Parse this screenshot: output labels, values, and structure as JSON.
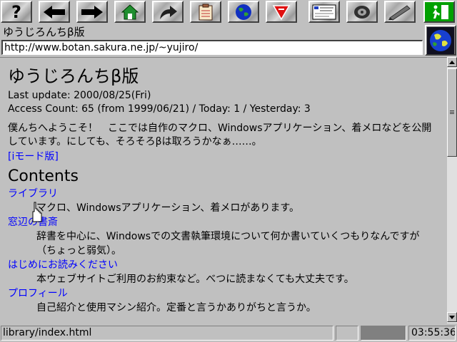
{
  "toolbar": {
    "buttons": [
      {
        "icon": "help-icon",
        "glyph": "?"
      },
      {
        "icon": "back-arrow-icon"
      },
      {
        "icon": "forward-arrow-icon"
      },
      {
        "icon": "home-icon"
      },
      {
        "icon": "reload-icon"
      },
      {
        "icon": "bookmarks-icon"
      },
      {
        "icon": "globe-icon"
      },
      {
        "icon": "stop-sign-icon"
      },
      {
        "icon": "document-preview-icon"
      },
      {
        "icon": "telephone-icon"
      },
      {
        "icon": "pen-icon"
      },
      {
        "icon": "exit-icon"
      }
    ]
  },
  "page": {
    "title": "ゆうじろんちβ版",
    "url": "http://www.botan.sakura.ne.jp/~yujiro/"
  },
  "content": {
    "heading": "ゆうじろんちβ版",
    "last_update": "Last update: 2000/08/25(Fri)",
    "access_count": "Access Count: 65 (from 1999/06/21) / Today: 1 / Yesterday: 3",
    "welcome": "僕んちへようこそ！　ここでは自作のマクロ、Windowsアプリケーション、着メロなどを公開しています。にしても、そろそろβは取ろうかなぁ……。",
    "imode_link": "[iモード版]",
    "contents_heading": "Contents",
    "sections": [
      {
        "title": "ライブラリ",
        "desc": "マクロ、Windowsアプリケーション、着メロがあります。"
      },
      {
        "title": "窓辺の書斎",
        "desc": "辞書を中心に、Windowsでの文書執筆環境について何か書いていくつもりなんですが（ちょっと弱気）。"
      },
      {
        "title": "はじめにお読みください",
        "desc": "本ウェブサイトご利用のお約束など。べつに読まなくても大丈夫です。"
      },
      {
        "title": "プロフィール",
        "desc": "自己紹介と使用マシン紹介。定番と言うかありがちと言うか。"
      }
    ]
  },
  "statusbar": {
    "link_target": "library/index.html",
    "time": "03:55:36"
  },
  "colors": {
    "background": "#c0c0c0",
    "link": "#0000ff",
    "progress": "#808080"
  }
}
